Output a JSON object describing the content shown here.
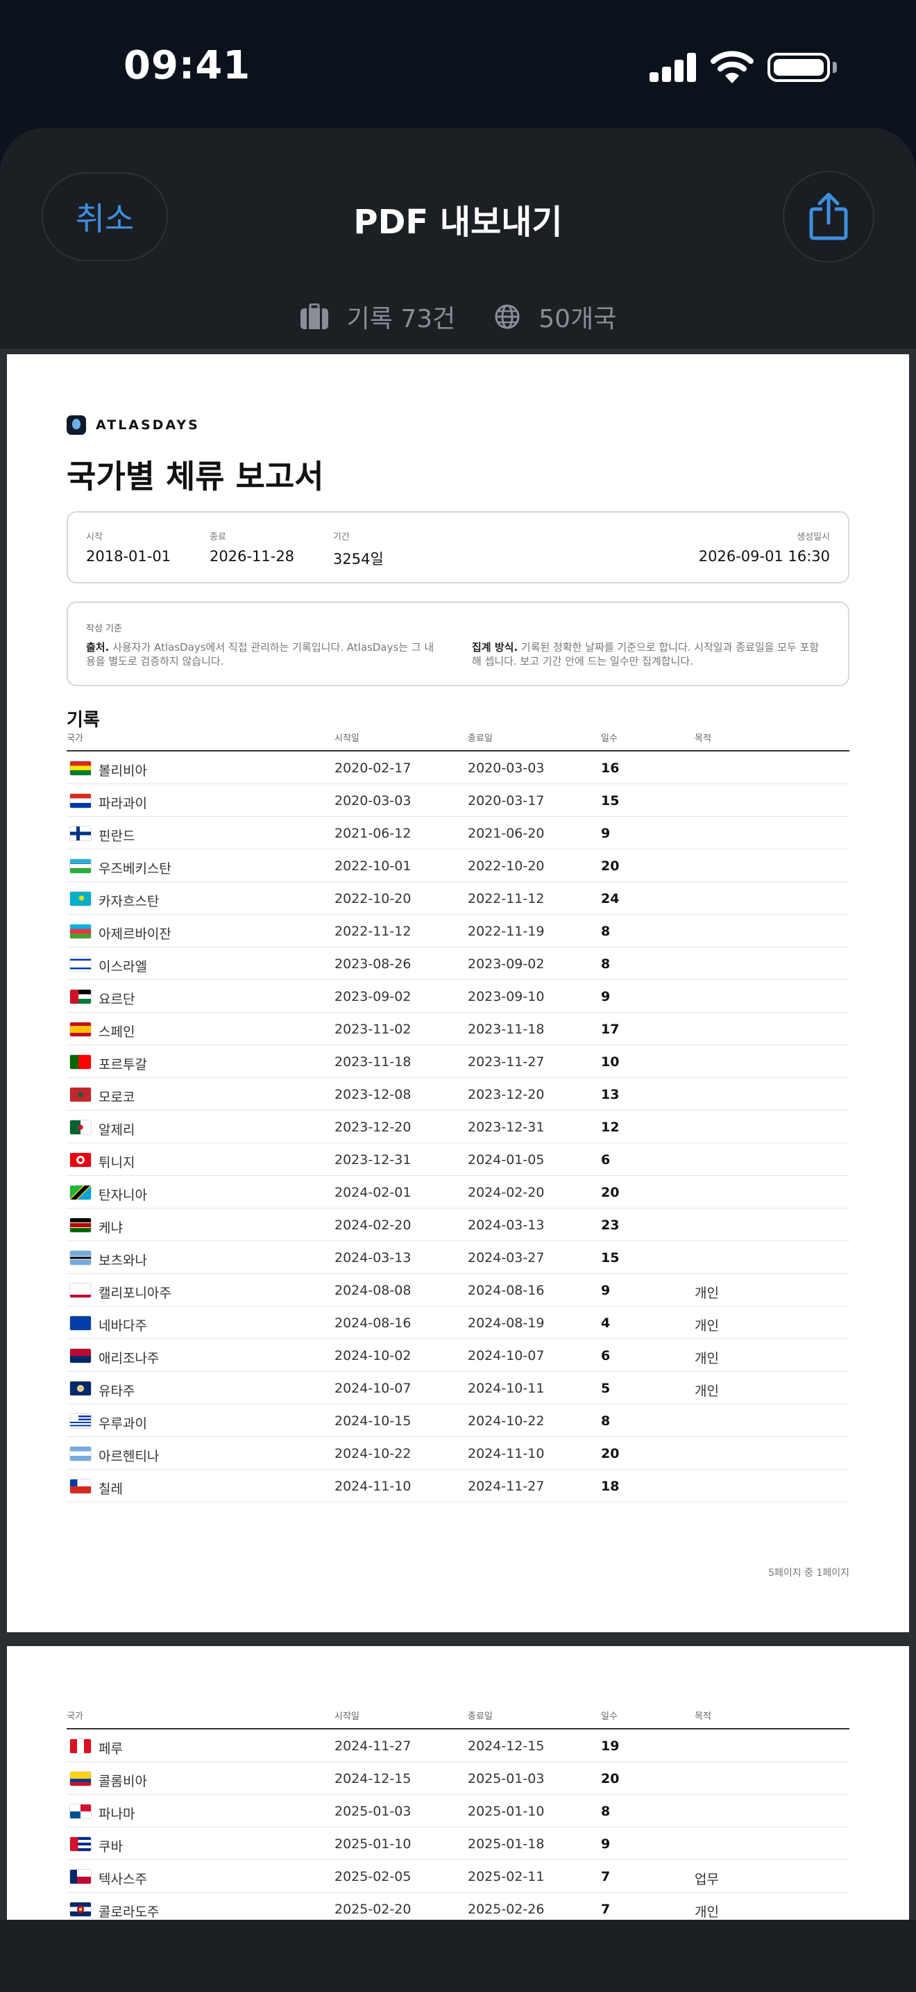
{
  "status": {
    "time": "09:41"
  },
  "sheet": {
    "cancel_label": "취소",
    "title": "PDF 내보내기",
    "share_icon": "share-icon",
    "summary_records": "기록 73건",
    "summary_countries": "50개국"
  },
  "report": {
    "brand": "ATLASDAYS",
    "title": "국가별 체류 보고서",
    "meta": {
      "start_label": "시작",
      "start_value": "2018-01-01",
      "end_label": "종료",
      "end_value": "2026-11-28",
      "period_label": "기간",
      "period_value": "3254일",
      "created_label": "생성일시",
      "created_value": "2026-09-01 16:30"
    },
    "note": {
      "label": "작성 기준",
      "source_title": "출처.",
      "source_text": " 사용자가 AtlasDays에서 직접 관리하는 기록입니다. AtlasDays는 그 내용을 별도로 검증하지 않습니다.",
      "method_title": "집계 방식.",
      "method_text": " 기록된 정확한 날짜를 기준으로 합니다. 시작일과 종료일을 모두 포함해 셉니다. 보고 기간 안에 드는 일수만 집계합니다."
    },
    "section_title": "기록",
    "columns": {
      "country": "국가",
      "start": "시작일",
      "end": "종료일",
      "days": "일수",
      "purpose": "목적"
    },
    "page_footer": "5페이지 중 1페이지",
    "page1_rows": [
      {
        "flag": "bolivia",
        "country": "볼리비아",
        "start": "2020-02-17",
        "end": "2020-03-03",
        "days": "16",
        "purpose": ""
      },
      {
        "flag": "paraguay",
        "country": "파라과이",
        "start": "2020-03-03",
        "end": "2020-03-17",
        "days": "15",
        "purpose": ""
      },
      {
        "flag": "finland",
        "country": "핀란드",
        "start": "2021-06-12",
        "end": "2021-06-20",
        "days": "9",
        "purpose": ""
      },
      {
        "flag": "uzbekistan",
        "country": "우즈베키스탄",
        "start": "2022-10-01",
        "end": "2022-10-20",
        "days": "20",
        "purpose": ""
      },
      {
        "flag": "kazakhstan",
        "country": "카자흐스탄",
        "start": "2022-10-20",
        "end": "2022-11-12",
        "days": "24",
        "purpose": ""
      },
      {
        "flag": "azerbaijan",
        "country": "아제르바이잔",
        "start": "2022-11-12",
        "end": "2022-11-19",
        "days": "8",
        "purpose": ""
      },
      {
        "flag": "israel",
        "country": "이스라엘",
        "start": "2023-08-26",
        "end": "2023-09-02",
        "days": "8",
        "purpose": ""
      },
      {
        "flag": "jordan",
        "country": "요르단",
        "start": "2023-09-02",
        "end": "2023-09-10",
        "days": "9",
        "purpose": ""
      },
      {
        "flag": "spain",
        "country": "스페인",
        "start": "2023-11-02",
        "end": "2023-11-18",
        "days": "17",
        "purpose": ""
      },
      {
        "flag": "portugal",
        "country": "포르투갈",
        "start": "2023-11-18",
        "end": "2023-11-27",
        "days": "10",
        "purpose": ""
      },
      {
        "flag": "morocco",
        "country": "모로코",
        "start": "2023-12-08",
        "end": "2023-12-20",
        "days": "13",
        "purpose": ""
      },
      {
        "flag": "algeria",
        "country": "알제리",
        "start": "2023-12-20",
        "end": "2023-12-31",
        "days": "12",
        "purpose": ""
      },
      {
        "flag": "tunisia",
        "country": "튀니지",
        "start": "2023-12-31",
        "end": "2024-01-05",
        "days": "6",
        "purpose": ""
      },
      {
        "flag": "tanzania",
        "country": "탄자니아",
        "start": "2024-02-01",
        "end": "2024-02-20",
        "days": "20",
        "purpose": ""
      },
      {
        "flag": "kenya",
        "country": "케냐",
        "start": "2024-02-20",
        "end": "2024-03-13",
        "days": "23",
        "purpose": ""
      },
      {
        "flag": "botswana",
        "country": "보츠와나",
        "start": "2024-03-13",
        "end": "2024-03-27",
        "days": "15",
        "purpose": ""
      },
      {
        "flag": "california",
        "country": "캘리포니아주",
        "start": "2024-08-08",
        "end": "2024-08-16",
        "days": "9",
        "purpose": "개인"
      },
      {
        "flag": "nevada",
        "country": "네바다주",
        "start": "2024-08-16",
        "end": "2024-08-19",
        "days": "4",
        "purpose": "개인"
      },
      {
        "flag": "arizona",
        "country": "애리조나주",
        "start": "2024-10-02",
        "end": "2024-10-07",
        "days": "6",
        "purpose": "개인"
      },
      {
        "flag": "utah",
        "country": "유타주",
        "start": "2024-10-07",
        "end": "2024-10-11",
        "days": "5",
        "purpose": "개인"
      },
      {
        "flag": "uruguay",
        "country": "우루과이",
        "start": "2024-10-15",
        "end": "2024-10-22",
        "days": "8",
        "purpose": ""
      },
      {
        "flag": "argentina",
        "country": "아르헨티나",
        "start": "2024-10-22",
        "end": "2024-11-10",
        "days": "20",
        "purpose": ""
      },
      {
        "flag": "chile",
        "country": "칠레",
        "start": "2024-11-10",
        "end": "2024-11-27",
        "days": "18",
        "purpose": ""
      }
    ],
    "page2_rows": [
      {
        "flag": "peru",
        "country": "페루",
        "start": "2024-11-27",
        "end": "2024-12-15",
        "days": "19",
        "purpose": ""
      },
      {
        "flag": "colombia",
        "country": "콜롬비아",
        "start": "2024-12-15",
        "end": "2025-01-03",
        "days": "20",
        "purpose": ""
      },
      {
        "flag": "panama",
        "country": "파나마",
        "start": "2025-01-03",
        "end": "2025-01-10",
        "days": "8",
        "purpose": ""
      },
      {
        "flag": "cuba",
        "country": "쿠바",
        "start": "2025-01-10",
        "end": "2025-01-18",
        "days": "9",
        "purpose": ""
      },
      {
        "flag": "texas",
        "country": "텍사스주",
        "start": "2025-02-05",
        "end": "2025-02-11",
        "days": "7",
        "purpose": "업무"
      },
      {
        "flag": "colorado",
        "country": "콜로라도주",
        "start": "2025-02-20",
        "end": "2025-02-26",
        "days": "7",
        "purpose": "개인"
      }
    ]
  }
}
